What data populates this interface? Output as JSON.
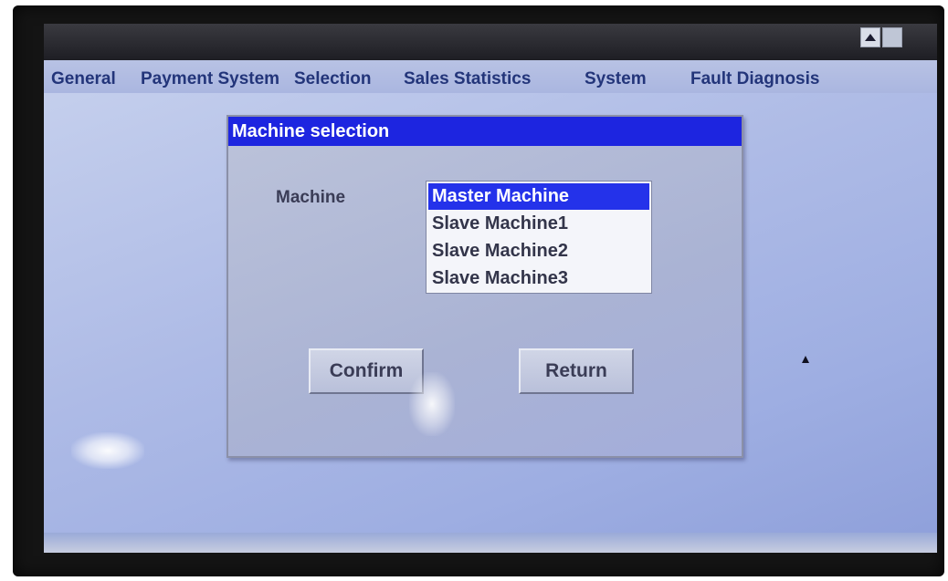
{
  "menu": {
    "items": [
      "General",
      "Payment System",
      "Selection",
      "Sales Statistics",
      "System",
      "Fault Diagnosis"
    ]
  },
  "window_controls": {
    "up_icon": "triangle-up-icon",
    "blank_icon": "square-icon"
  },
  "dialog": {
    "title": "Machine selection",
    "field_label": "Machine",
    "options": [
      "Master Machine",
      "Slave Machine1",
      "Slave Machine2",
      "Slave Machine3"
    ],
    "selected_index": 0,
    "confirm_label": "Confirm",
    "return_label": "Return"
  },
  "colors": {
    "title_bar": "#1d25e0",
    "selection": "#2432ea",
    "menu_text": "#23357a"
  }
}
